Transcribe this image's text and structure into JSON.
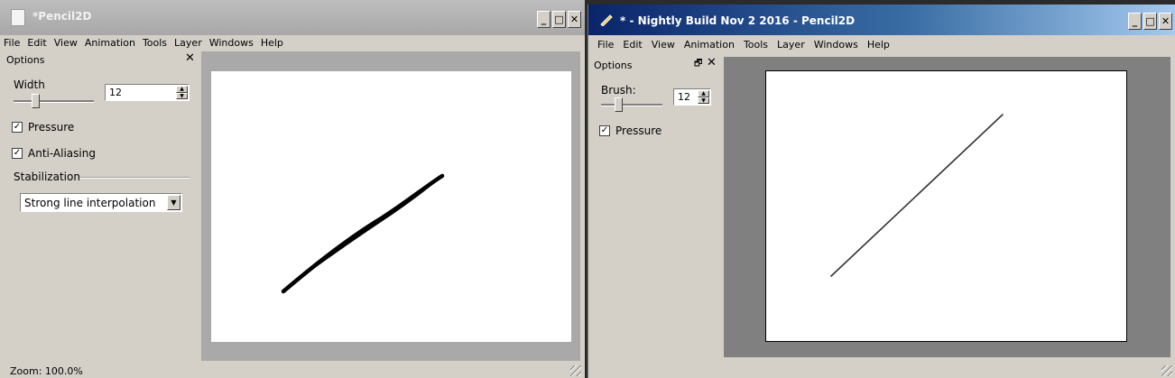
{
  "win1": {
    "title": "*Pencil2D",
    "menus": [
      "File",
      "Edit",
      "View",
      "Animation",
      "Tools",
      "Layer",
      "Windows",
      "Help"
    ],
    "options": {
      "title": "Options",
      "width_label": "Width",
      "width_value": "12",
      "pressure_label": "Pressure",
      "pressure_checked": true,
      "antialias_label": "Anti-Aliasing",
      "antialias_checked": true,
      "stabilization_label": "Stabilization",
      "stabilization_value": "Strong line interpolation"
    },
    "status": "Zoom: 100.0%"
  },
  "win2": {
    "title": "* - Nightly Build Nov  2 2016 - Pencil2D",
    "menus": [
      "File",
      "Edit",
      "View",
      "Animation",
      "Tools",
      "Layer",
      "Windows",
      "Help"
    ],
    "options": {
      "title": "Options",
      "brush_label": "Brush:",
      "brush_value": "12",
      "pressure_label": "Pressure",
      "pressure_checked": true
    }
  },
  "colors": {
    "win1_canvas_bg": "#a9a9a9",
    "win2_canvas_bg": "#808080",
    "win2_title_gradient_start": "#0a246a"
  }
}
